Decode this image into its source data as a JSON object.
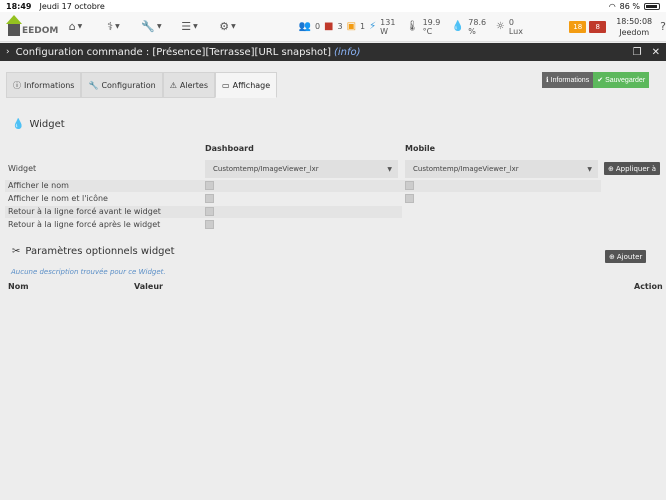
{
  "statusbar": {
    "time": "18:49",
    "date": "Jeudi 17 octobre",
    "wifi": "wifi",
    "battery_pct": "86 %"
  },
  "navbar": {
    "logo_text": "EEDOM",
    "widgets": {
      "presence": "0",
      "alarm": "3",
      "lock": "1",
      "power": "131 W",
      "temperature": "19.9 °C",
      "humidity": "78.6 %",
      "lux": "0 Lux"
    },
    "badges": [
      {
        "value": "18",
        "color": "#f39c12"
      },
      {
        "value": "8",
        "color": "#c0392b"
      }
    ],
    "clock_time": "18:50:08",
    "clock_label": "Jeedom"
  },
  "titlebar": {
    "title": "Configuration commande : [Présence][Terrasse][URL snapshot]",
    "info": "(info)"
  },
  "tabs": [
    {
      "label": "Informations",
      "icon": "info-circle-icon"
    },
    {
      "label": "Configuration",
      "icon": "wrench-icon"
    },
    {
      "label": "Alertes",
      "icon": "warning-icon"
    },
    {
      "label": "Affichage",
      "icon": "monitor-icon",
      "active": true
    }
  ],
  "buttons": {
    "informations": "Informations",
    "save": "Sauvegarder",
    "apply": "Appliquer à",
    "add": "Ajouter"
  },
  "widget_section": {
    "title": "Widget",
    "col_dashboard": "Dashboard",
    "col_mobile": "Mobile",
    "rows": {
      "widget": "Widget",
      "show_name": "Afficher le nom",
      "show_name_icon": "Afficher le nom et l'icône",
      "break_before": "Retour à la ligne forcé avant le widget",
      "break_after": "Retour à la ligne forcé après le widget"
    },
    "dashboard_widget": "Customtemp/ImageViewer_lxr",
    "mobile_widget": "Customtemp/ImageViewer_lxr"
  },
  "params_section": {
    "title": "Paramètres optionnels widget",
    "description": "Aucune description trouvée pour ce Widget.",
    "col_name": "Nom",
    "col_value": "Valeur",
    "col_action": "Action"
  }
}
